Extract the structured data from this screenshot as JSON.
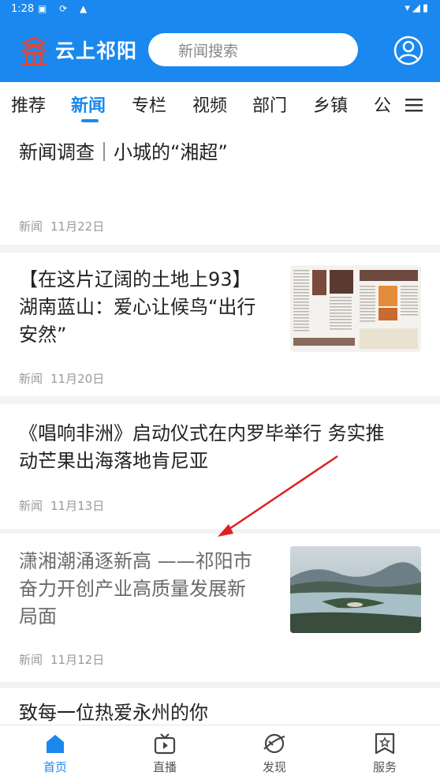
{
  "status_bar": {
    "time": "1:28"
  },
  "header": {
    "app_name": "云上祁阳",
    "search_placeholder": "新闻搜索"
  },
  "tabs": [
    {
      "label": "推荐"
    },
    {
      "label": "新闻",
      "active": true
    },
    {
      "label": "专栏"
    },
    {
      "label": "视频"
    },
    {
      "label": "部门"
    },
    {
      "label": "乡镇"
    },
    {
      "label": "公"
    }
  ],
  "articles": [
    {
      "title_lines": [
        "新闻调查｜小城的“湘超”"
      ],
      "category": "新闻",
      "date": "11月22日",
      "has_thumb": false
    },
    {
      "title_lines": [
        "【在这片辽阔的土地上93】",
        "湖南蓝山：爱心让候鸟“出行",
        "安然”"
      ],
      "category": "新闻",
      "date": "11月20日",
      "has_thumb": true,
      "thumb": "newspaper-thumbnail"
    },
    {
      "title_lines": [
        "《唱响非洲》启动仪式在内罗毕举行 务实推",
        "动芒果出海落地肯尼亚"
      ],
      "category": "新闻",
      "date": "11月13日",
      "has_thumb": false
    },
    {
      "title_lines": [
        "潇湘潮涌逐新高 ——祁阳市",
        "奋力开创产业高质量发展新",
        "局面"
      ],
      "category": "新闻",
      "date": "11月12日",
      "has_thumb": true,
      "thumb": "lake-landscape-thumbnail",
      "read": true
    },
    {
      "title_lines": [
        "致每一位热爱永州的你"
      ]
    }
  ],
  "bottom_nav": [
    {
      "label": "首页",
      "icon": "home-icon",
      "active": true
    },
    {
      "label": "直播",
      "icon": "tv-icon"
    },
    {
      "label": "发现",
      "icon": "discover-icon"
    },
    {
      "label": "服务",
      "icon": "service-icon"
    }
  ],
  "colors": {
    "brand": "#1a88ee",
    "annotation": "#e02020"
  }
}
